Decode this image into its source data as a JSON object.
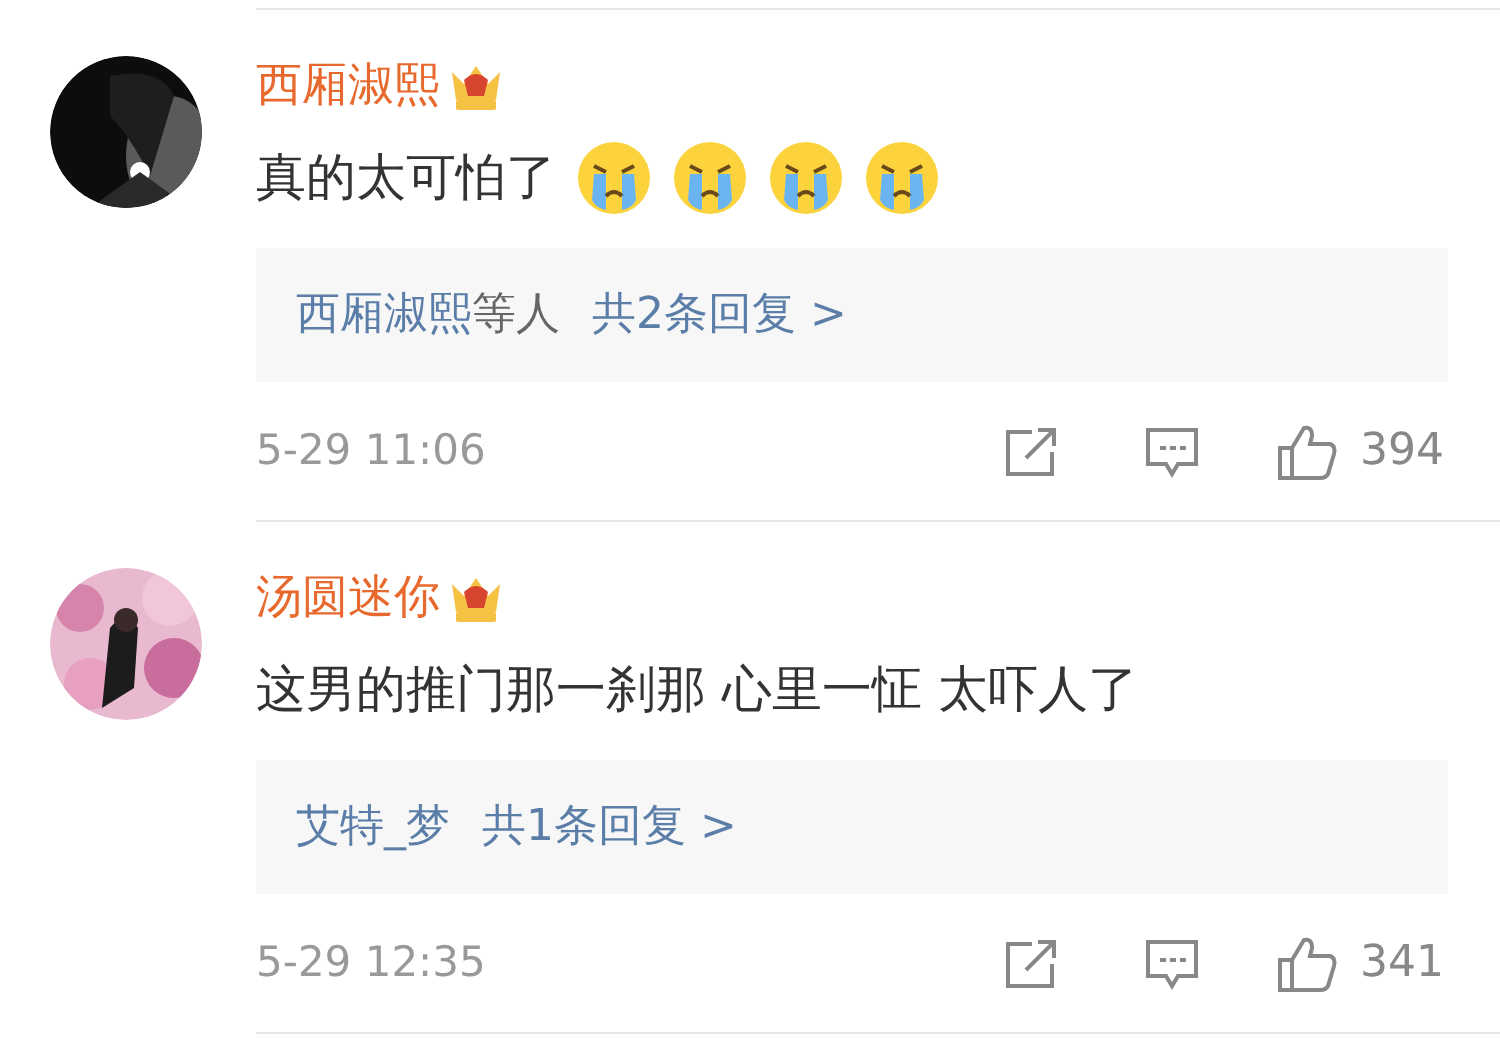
{
  "comments": [
    {
      "author": "西厢淑熙",
      "text": "真的太可怕了",
      "emojis": [
        {
          "kind": "crying"
        },
        {
          "kind": "crying"
        },
        {
          "kind": "crying"
        },
        {
          "kind": "crying"
        }
      ],
      "replies": {
        "names": "西厢淑熙",
        "suffix": "等人",
        "link": "共2条回复 >"
      },
      "time": "5-29 11:06",
      "likes": "394"
    },
    {
      "author": "汤圆迷你",
      "text": "这男的推门那一刹那 心里一怔 太吓人了",
      "replies": {
        "names": "艾特_梦",
        "link": "共1条回复 >"
      },
      "time": "5-29 12:35",
      "likes": "341"
    }
  ]
}
